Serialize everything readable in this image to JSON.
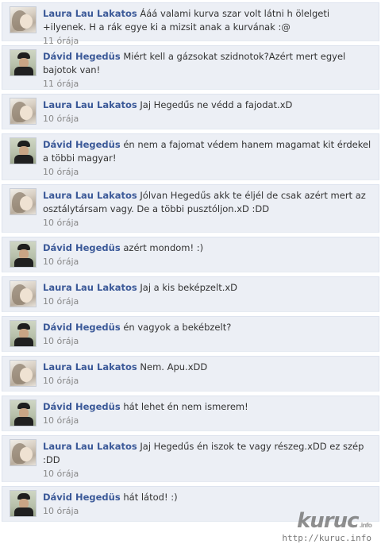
{
  "comments": [
    {
      "author": "Laura Lau Lakatos",
      "text": "Ááá valami kurva szar volt látni h ölelgeti +ilyenek. H a rák egye ki a mizsit anak a kurvának :@",
      "time": "11 órája",
      "avatar": "laura"
    },
    {
      "author": "Dávid Hegedüs",
      "text": "Miért kell a gázsokat szidnotok?Azért mert egyel bajotok van!",
      "time": "11 órája",
      "avatar": "david"
    },
    {
      "author": "Laura Lau Lakatos",
      "text": "Jaj Hegedűs ne védd a fajodat.xD",
      "time": "10 órája",
      "avatar": "laura"
    },
    {
      "author": "Dávid Hegedüs",
      "text": "én nem a fajomat védem hanem magamat kit érdekel a többi magyar!",
      "time": "10 órája",
      "avatar": "david"
    },
    {
      "author": "Laura Lau Lakatos",
      "text": "Jólvan Hegedűs akk te éljél de csak azért mert az osztálytársam vagy. De a többi pusztóljon.xD :DD",
      "time": "10 órája",
      "avatar": "laura"
    },
    {
      "author": "Dávid Hegedüs",
      "text": "azért mondom! :)",
      "time": "10 órája",
      "avatar": "david"
    },
    {
      "author": "Laura Lau Lakatos",
      "text": "Jaj a kis beképzelt.xD",
      "time": "10 órája",
      "avatar": "laura"
    },
    {
      "author": "Dávid Hegedüs",
      "text": "én vagyok a bekébzelt?",
      "time": "10 órája",
      "avatar": "david"
    },
    {
      "author": "Laura Lau Lakatos",
      "text": "Nem. Apu.xDD",
      "time": "10 órája",
      "avatar": "laura"
    },
    {
      "author": "Dávid Hegedüs",
      "text": "hát lehet én nem ismerem!",
      "time": "10 órája",
      "avatar": "david"
    },
    {
      "author": "Laura Lau Lakatos",
      "text": "Jaj Hegedűs én iszok te vagy részeg.xDD ez szép :DD",
      "time": "10 órája",
      "avatar": "laura"
    },
    {
      "author": "Dávid Hegedüs",
      "text": "hát látod! :)",
      "time": "10 órája",
      "avatar": "david"
    }
  ],
  "watermark": {
    "logo": "kuruc",
    "logo_suffix": ".info",
    "url": "http://kuruc.info"
  },
  "colors": {
    "author_link": "#3b5998",
    "comment_bg": "#eceff5",
    "time_text": "#888888"
  }
}
